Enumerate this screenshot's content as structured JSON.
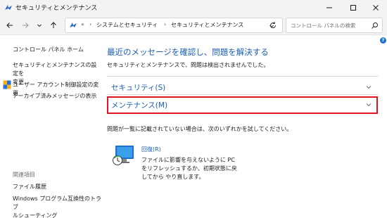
{
  "window": {
    "title": "セキュリティとメンテナンス"
  },
  "address_bar": {
    "overflow": "«",
    "crumbs": [
      "システムとセキュリティ",
      "セキュリティとメンテナンス"
    ],
    "separator": "›"
  },
  "search": {
    "placeholder": "コントロール パネルの検索"
  },
  "help_label": "?",
  "sidebar": {
    "home": "コントロール パネル ホーム",
    "items": [
      {
        "line1": "セキュリティとメンテナンスの設定を",
        "line2": "変更"
      },
      {
        "line1": "ユーザー アカウント制御設定の変更"
      },
      {
        "line1": "アーカイブ済みメッセージの表示"
      }
    ],
    "related_heading": "関連項目",
    "related": [
      {
        "line1": "ファイル履歴"
      },
      {
        "line1": "Windows プログラム互換性のトラブ",
        "line2": "ルシューティング"
      }
    ]
  },
  "main": {
    "title": "最近のメッセージを確認し、問題を解決する",
    "subtitle": "セキュリティとメンテナンスで、問題は検出されませんでした。",
    "sections": [
      {
        "label": "セキュリティ(S)"
      },
      {
        "label": "メンテナンス(M)"
      }
    ],
    "note": "問題が一覧に記載されていない場合は、次のいずれかを試してください。",
    "recovery": {
      "title": "回復(R)",
      "desc": [
        "ファイルに影響を与えないように PC",
        "をリフレッシュするか、初期状態に戻",
        "してから やり直します。"
      ]
    }
  },
  "colors": {
    "link": "#1a5fb4",
    "highlight_border": "#e0141e",
    "chrome": "#f3f3f3"
  },
  "icons": [
    "control-panel-icon",
    "minimize-icon",
    "maximize-icon",
    "close-icon",
    "back-icon",
    "forward-icon",
    "up-icon",
    "dropdown-icon",
    "refresh-icon",
    "search-icon",
    "shield-icon",
    "chevron-down-icon",
    "recovery-icon"
  ]
}
